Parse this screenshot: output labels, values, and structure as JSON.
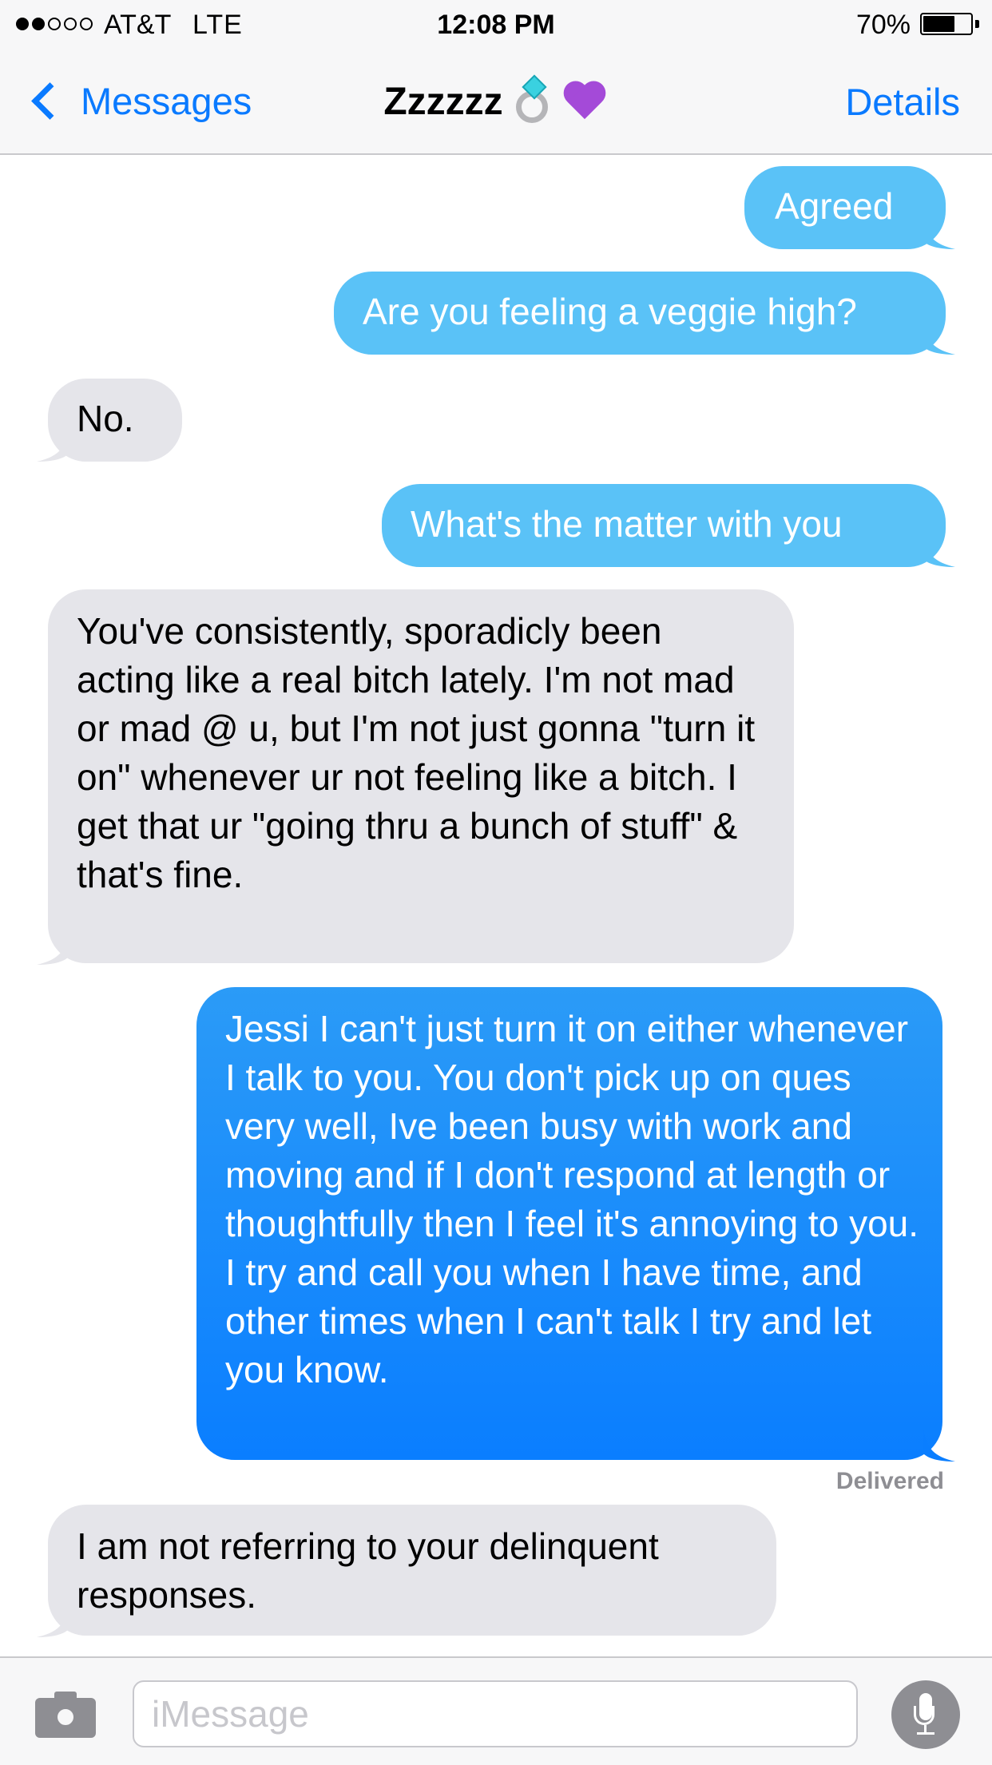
{
  "status_bar": {
    "signal_filled": 2,
    "signal_total": 5,
    "carrier": "AT&T",
    "network": "LTE",
    "time": "12:08 PM",
    "battery_percent": "70%",
    "battery_level": 0.7
  },
  "nav": {
    "back_label": "Messages",
    "title": "Zzzzzz",
    "title_icons": [
      "ring-icon",
      "purple-heart-icon"
    ],
    "details_label": "Details"
  },
  "messages": [
    {
      "direction": "outgoing",
      "text": "Agreed"
    },
    {
      "direction": "outgoing",
      "text": "Are you feeling a veggie high?"
    },
    {
      "direction": "incoming",
      "text": "No."
    },
    {
      "direction": "outgoing",
      "text": "What's the matter with you"
    },
    {
      "direction": "incoming",
      "text": "You've consistently,  sporadicly been acting like a real bitch lately. I'm not mad or mad @ u, but I'm not just gonna \"turn it on\" whenever ur not feeling like a bitch. I get that ur \"going thru a bunch of stuff\" & that's fine."
    },
    {
      "direction": "outgoing",
      "text": "Jessi I can't just turn it on either whenever I talk to you. You don't pick up on ques very well, Ive been busy with work and moving and if I don't respond at length or thoughtfully then I feel it's annoying to you. I try and call you when I have time, and other times when I can't talk I try and let you know."
    },
    {
      "direction": "incoming",
      "text": "I am not referring to your delinquent responses."
    }
  ],
  "delivered_label": "Delivered",
  "input_bar": {
    "camera_icon": "camera-icon",
    "placeholder": "iMessage",
    "mic_icon": "microphone-icon"
  },
  "colors": {
    "ios_blue": "#0a7aff",
    "outgoing_light": "#5ac2f7",
    "outgoing_dark": "#0a7eff",
    "incoming_gray": "#e5e5ea"
  }
}
